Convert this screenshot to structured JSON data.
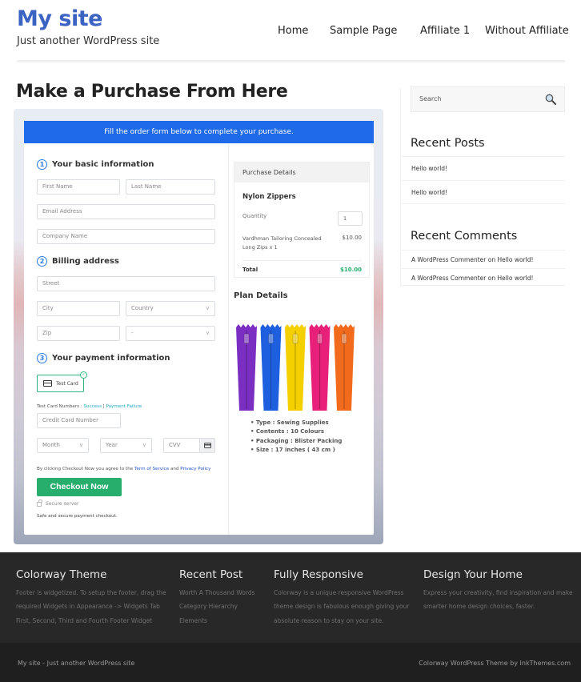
{
  "header": {
    "site_title": "My site",
    "tagline": "Just another WordPress site",
    "nav": [
      "Home",
      "Sample Page",
      "Affiliate 1",
      "Without Affiliate"
    ]
  },
  "page": {
    "title": "Make a Purchase From Here"
  },
  "checkout": {
    "banner": "Fill the order form below to complete your purchase.",
    "sections": {
      "basic": {
        "num": "1",
        "title": "Your basic information"
      },
      "billing": {
        "num": "2",
        "title": "Billing address"
      },
      "payment": {
        "num": "3",
        "title": "Your payment information"
      }
    },
    "fields": {
      "first_name": "First Name",
      "last_name": "Last Name",
      "email": "Email Address",
      "company": "Company Name",
      "street": "Street",
      "city": "City",
      "country": "Country",
      "zip": "Zip",
      "state": "-",
      "card_number": "Credit Card Number",
      "month": "Month",
      "year": "Year",
      "cvv": "CVV"
    },
    "payment_method": "Test Card",
    "test_numbers_label": "Test Card Numbers : ",
    "test_success": "Success",
    "test_sep": " | ",
    "test_failure": "Payment Failure",
    "agree_prefix": "By clicking Checkout Now you agree to the ",
    "terms_link": "Term of Service",
    "agree_and": " and ",
    "privacy_link": "Privacy Policy",
    "checkout_button": "Checkout Now",
    "secure_server": "Secure server",
    "safe_text": "Safe and secure payment checkout.",
    "purchase": {
      "heading": "Purchase Details",
      "product": "Nylon Zippers",
      "quantity_label": "Quantity",
      "quantity": "1",
      "item_desc": "Vardhman Tailoring Concealed Long Zips x 1",
      "item_price": "$10.00",
      "total_label": "Total",
      "total_value": "$10.00"
    },
    "plan": {
      "title": "Plan Details",
      "image_alt": "zippers-image",
      "zipper_colors": [
        "#7b2fc2",
        "#1e5fe0",
        "#f5d000",
        "#e8207a",
        "#f26b1d"
      ],
      "features": [
        "Type : Sewing Supplies",
        "Contents : 10 Colours",
        "Packaging : Blister Packing",
        "Size : 17 inches ( 43 cm )"
      ]
    }
  },
  "sidebar": {
    "search_placeholder": "Search",
    "recent_posts_title": "Recent Posts",
    "recent_posts": [
      "Hello world!",
      "Hello world!"
    ],
    "recent_comments_title": "Recent Comments",
    "recent_comments": [
      "A WordPress Commenter on Hello world!",
      "A WordPress Commenter on Hello world!"
    ]
  },
  "footer": {
    "columns": [
      {
        "title": "Colorway Theme",
        "lines": [
          "Footer is widgetized. To setup the footer, drag the",
          "required Widgets in Appearance -> Widgets Tab",
          "First, Second, Third and Fourth Footer Widget"
        ]
      },
      {
        "title": "Recent Post",
        "lines": [
          "Worth A Thousand Words",
          "Category Hierarchy",
          "Elements"
        ]
      },
      {
        "title": "Fully Responsive",
        "lines": [
          "Colorway is a unique responsive WordPress",
          "theme design is fabulous enough giving your",
          "absolute reason to stay on your site."
        ]
      },
      {
        "title": "Design Your Home",
        "lines": [
          "Express your creativity, find inspiration and make",
          "smarter home design choices, faster."
        ]
      }
    ],
    "bottom_left": "My site - Just another WordPress site",
    "bottom_right": "Colorway WordPress Theme by InkThemes.com"
  },
  "colors": {
    "brand_blue": "#3b63c4",
    "banner_blue": "#1f6ae8",
    "checkout_green": "#27ae6c",
    "footer_bg": "#282828"
  }
}
